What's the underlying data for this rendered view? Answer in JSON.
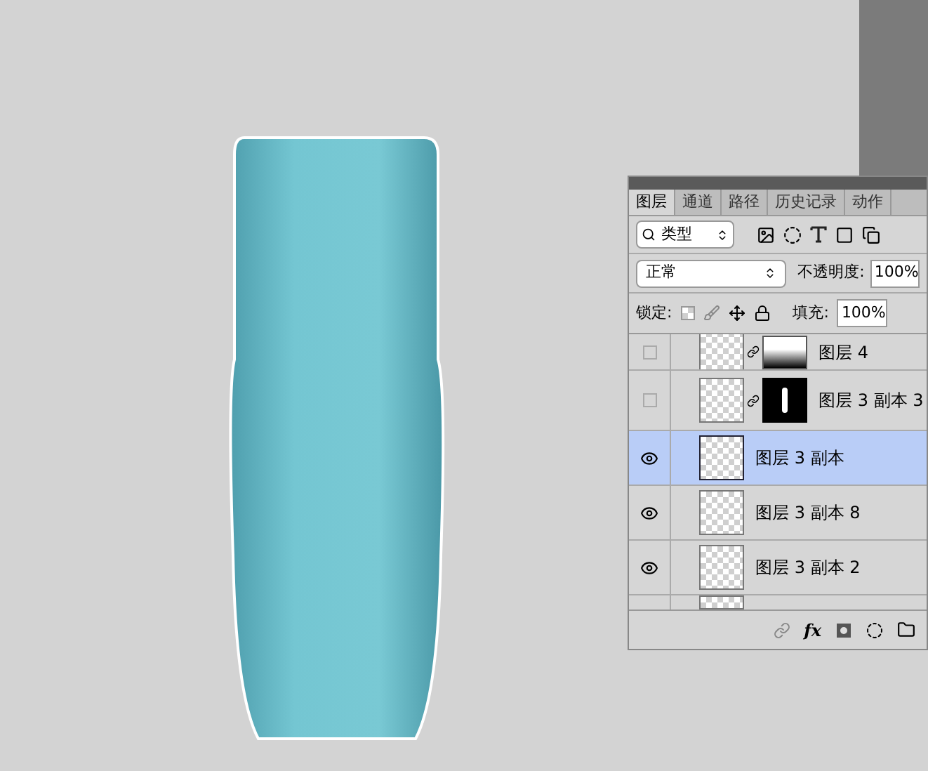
{
  "layers_panel": {
    "tabs": [
      {
        "label": "图层",
        "selected": true
      },
      {
        "label": "通道",
        "selected": false
      },
      {
        "label": "路径",
        "selected": false
      },
      {
        "label": "历史记录",
        "selected": false
      },
      {
        "label": "动作",
        "selected": false
      }
    ],
    "filter": {
      "value": "类型"
    },
    "blend_mode": {
      "value": "正常"
    },
    "opacity": {
      "label": "不透明度:",
      "value": "100%"
    },
    "lock": {
      "label": "锁定:"
    },
    "fill": {
      "label": "填充:",
      "value": "100%"
    },
    "layers": [
      {
        "name": "图层 4",
        "visible": false,
        "selected": false,
        "kind": "gradient"
      },
      {
        "name": "图层 3 副本 3",
        "visible": false,
        "selected": false,
        "kind": "shape"
      },
      {
        "name": "图层 3 副本",
        "visible": true,
        "selected": true,
        "kind": "plain"
      },
      {
        "name": "图层 3 副本 8",
        "visible": true,
        "selected": false,
        "kind": "plain"
      },
      {
        "name": "图层 3 副本 2",
        "visible": true,
        "selected": false,
        "kind": "plain"
      }
    ],
    "footer": {
      "effects_label": "fx"
    }
  }
}
